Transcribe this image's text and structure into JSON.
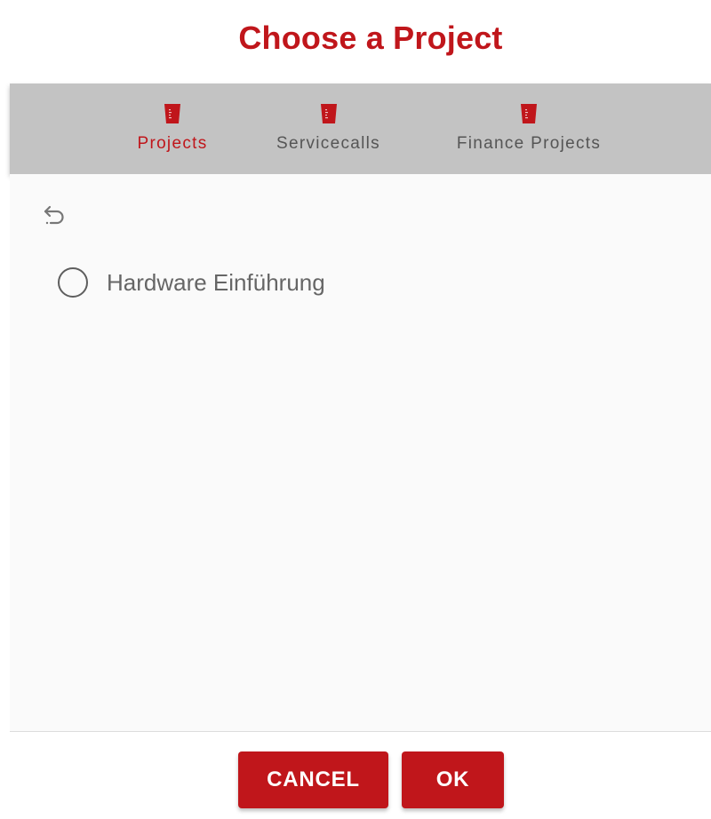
{
  "dialog": {
    "title": "Choose a Project"
  },
  "tabs": [
    {
      "label": "Projects",
      "icon": "beaker-icon",
      "active": true
    },
    {
      "label": "Servicecalls",
      "icon": "beaker-icon",
      "active": false
    },
    {
      "label": "Finance Projects",
      "icon": "beaker-icon",
      "active": false
    }
  ],
  "list": {
    "back_icon": "undo-icon",
    "items": [
      {
        "label": "Hardware Einführung",
        "selected": false
      }
    ]
  },
  "actions": {
    "cancel_label": "CANCEL",
    "ok_label": "OK"
  },
  "colors": {
    "accent": "#c0161b",
    "tabbar_bg": "#c3c3c3",
    "inactive_text": "#555555"
  }
}
